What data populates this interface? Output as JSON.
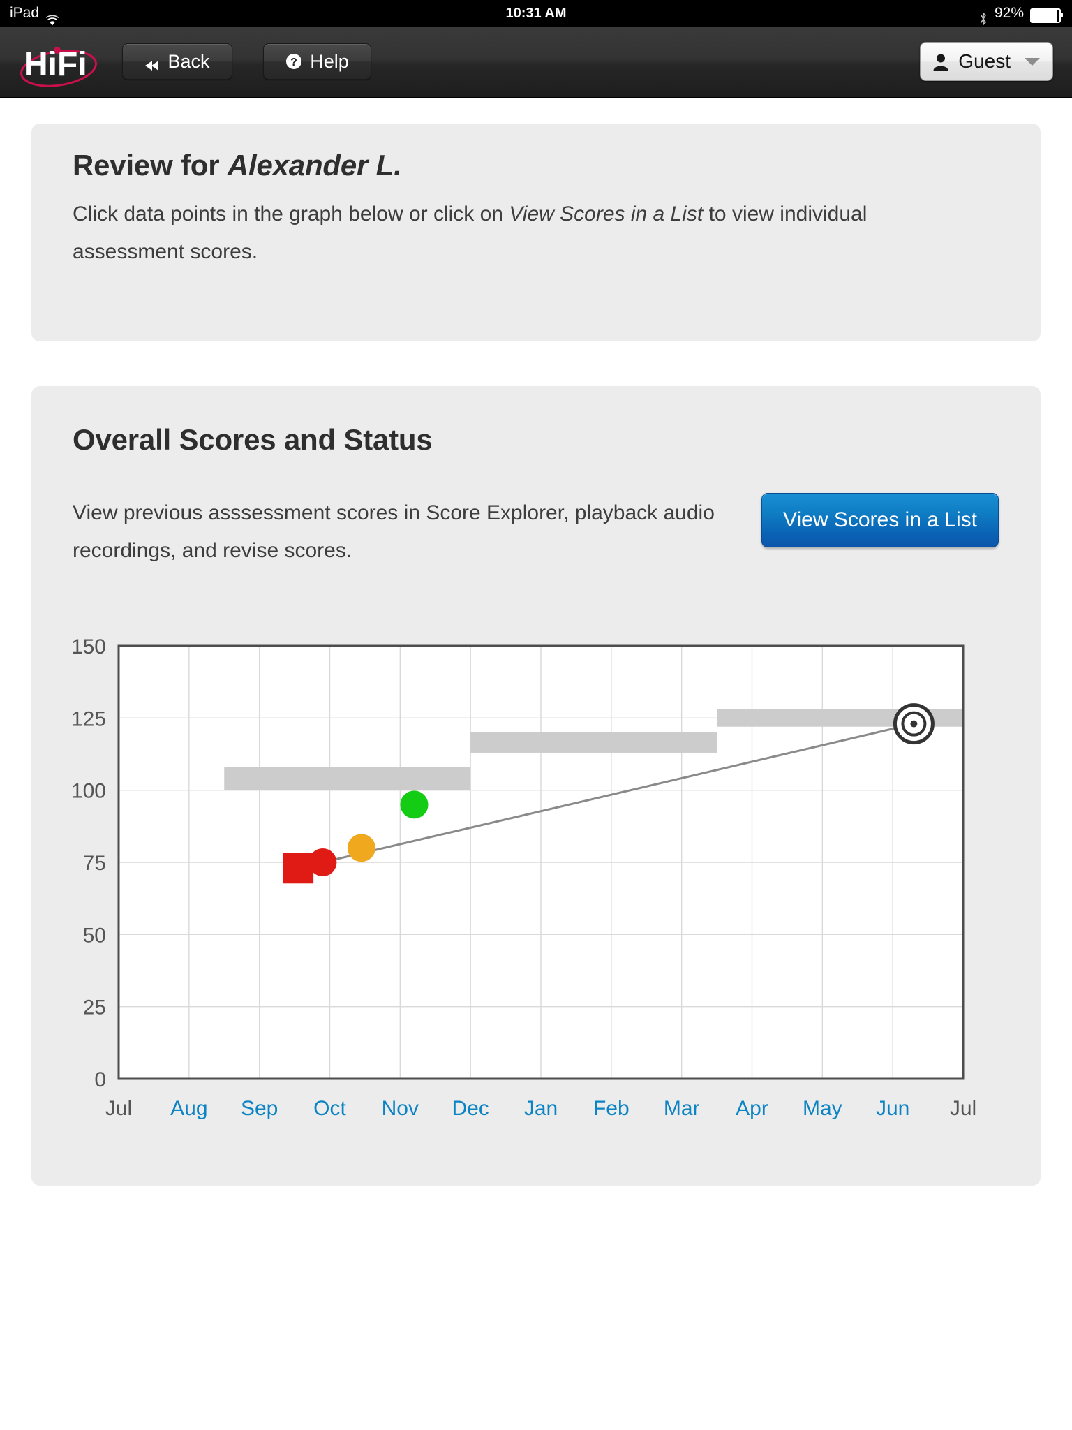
{
  "statusbar": {
    "carrier": "iPad",
    "wifi_icon": "wifi-icon",
    "time": "10:31 AM",
    "bluetooth_icon": "bluetooth-icon",
    "battery_percent": "92%",
    "battery_level": 92
  },
  "header": {
    "logo_text": "HiFi",
    "back_label": "Back",
    "back_icon": "rewind-icon",
    "help_label": "Help",
    "help_icon": "question-mark-icon",
    "user_label": "Guest",
    "user_icon": "person-icon",
    "dropdown_icon": "chevron-down-icon"
  },
  "review_panel": {
    "title_prefix": "Review for ",
    "title_student": "Alexander L.",
    "instructions_part1": "Click data points in the graph below or click on ",
    "instructions_emphasis": "View Scores in a List",
    "instructions_part2": " to view individual assessment scores."
  },
  "scores_panel": {
    "title": "Overall Scores and Status",
    "description": "View previous asssessment scores in Score Explorer, playback audio recordings, and revise scores.",
    "view_list_button": "View Scores in a List"
  },
  "chart_data": {
    "type": "scatter",
    "title": "",
    "xlabel": "",
    "ylabel": "",
    "ylim": [
      0,
      150
    ],
    "yticks": [
      0,
      25,
      50,
      75,
      100,
      125,
      150
    ],
    "ytick_labels": [
      "0",
      "25",
      "50",
      "75",
      "100",
      "125",
      "150"
    ],
    "grid": true,
    "legend": "none",
    "categories": [
      "Jul",
      "Aug",
      "Sep",
      "Oct",
      "Nov",
      "Dec",
      "Jan",
      "Feb",
      "Mar",
      "Apr",
      "May",
      "Jun",
      "Jul"
    ],
    "xtick_colors": [
      "#555555",
      "#0b83c4",
      "#0b83c4",
      "#0b83c4",
      "#0b83c4",
      "#0b83c4",
      "#0b83c4",
      "#0b83c4",
      "#0b83c4",
      "#0b83c4",
      "#0b83c4",
      "#0b83c4",
      "#555555"
    ],
    "points": [
      {
        "label": "benchmark-score",
        "month": "Sep",
        "x": 2.55,
        "y": 73,
        "shape": "square",
        "color": "#e01b15",
        "status": "red"
      },
      {
        "label": "assessment-score",
        "month": "Sep",
        "x": 2.9,
        "y": 75,
        "shape": "circle",
        "color": "#e01b15",
        "status": "red"
      },
      {
        "label": "assessment-score",
        "month": "Oct",
        "x": 3.45,
        "y": 80,
        "shape": "circle",
        "color": "#f0a81e",
        "status": "yellow"
      },
      {
        "label": "assessment-score",
        "month": "Nov",
        "x": 4.2,
        "y": 95,
        "shape": "circle",
        "color": "#14cc14",
        "status": "green"
      },
      {
        "label": "goal-target",
        "month": "Jun",
        "x": 11.3,
        "y": 123,
        "shape": "bullseye",
        "color": "#333333",
        "status": "target"
      }
    ],
    "goal_line": {
      "name": "Goal line",
      "from": {
        "x": 2.9,
        "y": 75
      },
      "to": {
        "x": 11.3,
        "y": 123
      },
      "color": "#8a8a8a"
    },
    "benchmark_bands": [
      {
        "name": "benchmark-band-1",
        "x_start": 1.5,
        "x_end": 5.0,
        "y_low": 100,
        "y_high": 108,
        "color": "#cccccc"
      },
      {
        "name": "benchmark-band-2",
        "x_start": 5.0,
        "x_end": 8.5,
        "y_low": 113,
        "y_high": 120,
        "color": "#cccccc"
      },
      {
        "name": "benchmark-band-3",
        "x_start": 8.5,
        "x_end": 12.0,
        "y_low": 122,
        "y_high": 128,
        "color": "#cccccc"
      }
    ]
  },
  "colors": {
    "accent_blue": "#0b83c4",
    "panel_bg": "#ececec",
    "page_bg": "#ffffff",
    "status_red": "#e01b15",
    "status_yellow": "#f0a81e",
    "status_green": "#14cc14",
    "band_gray": "#cccccc",
    "logo_red": "#c8104a"
  }
}
